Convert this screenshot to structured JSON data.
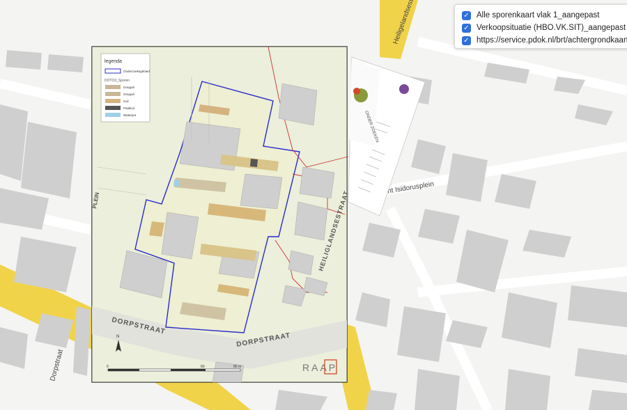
{
  "layers": [
    {
      "label": "Alle sporenkaart vlak 1_aangepast",
      "checked": true
    },
    {
      "label": "Verkoopsituatie (HBO.VK.SIT)_aangepast",
      "checked": true
    },
    {
      "label": "https://service.pdok.nl/brt/achtergrondkaart/wmts",
      "checked": true
    }
  ],
  "basemap_labels": {
    "street_top": "Heiligelandsestr",
    "plein": "Sint Isidorusplein",
    "street_left": "Dorpstraat"
  },
  "overlay_map": {
    "legend_title": "legenda",
    "legend_items": [
      {
        "label": "Onderzoeksgebied",
        "color": "#2a2acc"
      },
      {
        "label": "Greppel",
        "color": "#c7b798"
      },
      {
        "label": "Kuil",
        "color": "#d6b27f"
      },
      {
        "label": "Paalkuil",
        "color": "#555555"
      },
      {
        "label": "Waterput",
        "color": "#9fd0e8"
      }
    ],
    "legend_section": "DOTO3_Sporen",
    "legend_sub": "Greppel",
    "street_dorpstraat": "DORPSTRAAT",
    "street_heiligelandsestraat": "HEILIGLANDSESTRAAT",
    "street_plein": "PLEIN",
    "company_logo": "RAAP",
    "north_label": "N",
    "scale_0": "0",
    "scale_60": "60",
    "scale_80": "80 m",
    "titleblock_logo": "ONDER ZOEKEN"
  }
}
